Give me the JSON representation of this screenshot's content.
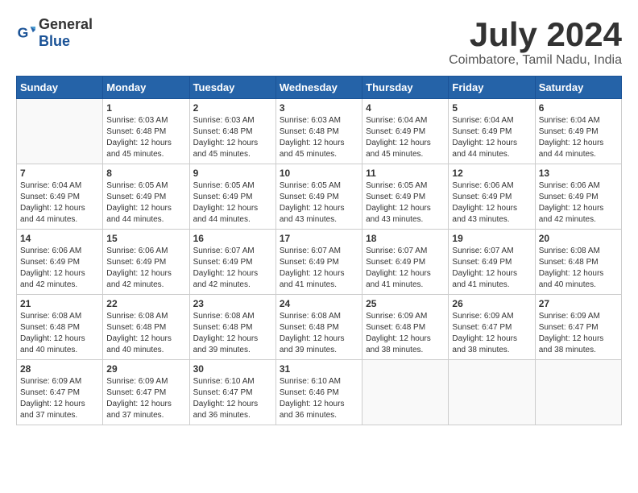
{
  "logo": {
    "general": "General",
    "blue": "Blue"
  },
  "title": {
    "month_year": "July 2024",
    "location": "Coimbatore, Tamil Nadu, India"
  },
  "calendar": {
    "headers": [
      "Sunday",
      "Monday",
      "Tuesday",
      "Wednesday",
      "Thursday",
      "Friday",
      "Saturday"
    ],
    "weeks": [
      [
        {
          "day": "",
          "info": ""
        },
        {
          "day": "1",
          "info": "Sunrise: 6:03 AM\nSunset: 6:48 PM\nDaylight: 12 hours\nand 45 minutes."
        },
        {
          "day": "2",
          "info": "Sunrise: 6:03 AM\nSunset: 6:48 PM\nDaylight: 12 hours\nand 45 minutes."
        },
        {
          "day": "3",
          "info": "Sunrise: 6:03 AM\nSunset: 6:48 PM\nDaylight: 12 hours\nand 45 minutes."
        },
        {
          "day": "4",
          "info": "Sunrise: 6:04 AM\nSunset: 6:49 PM\nDaylight: 12 hours\nand 45 minutes."
        },
        {
          "day": "5",
          "info": "Sunrise: 6:04 AM\nSunset: 6:49 PM\nDaylight: 12 hours\nand 44 minutes."
        },
        {
          "day": "6",
          "info": "Sunrise: 6:04 AM\nSunset: 6:49 PM\nDaylight: 12 hours\nand 44 minutes."
        }
      ],
      [
        {
          "day": "7",
          "info": "Sunrise: 6:04 AM\nSunset: 6:49 PM\nDaylight: 12 hours\nand 44 minutes."
        },
        {
          "day": "8",
          "info": "Sunrise: 6:05 AM\nSunset: 6:49 PM\nDaylight: 12 hours\nand 44 minutes."
        },
        {
          "day": "9",
          "info": "Sunrise: 6:05 AM\nSunset: 6:49 PM\nDaylight: 12 hours\nand 44 minutes."
        },
        {
          "day": "10",
          "info": "Sunrise: 6:05 AM\nSunset: 6:49 PM\nDaylight: 12 hours\nand 43 minutes."
        },
        {
          "day": "11",
          "info": "Sunrise: 6:05 AM\nSunset: 6:49 PM\nDaylight: 12 hours\nand 43 minutes."
        },
        {
          "day": "12",
          "info": "Sunrise: 6:06 AM\nSunset: 6:49 PM\nDaylight: 12 hours\nand 43 minutes."
        },
        {
          "day": "13",
          "info": "Sunrise: 6:06 AM\nSunset: 6:49 PM\nDaylight: 12 hours\nand 42 minutes."
        }
      ],
      [
        {
          "day": "14",
          "info": "Sunrise: 6:06 AM\nSunset: 6:49 PM\nDaylight: 12 hours\nand 42 minutes."
        },
        {
          "day": "15",
          "info": "Sunrise: 6:06 AM\nSunset: 6:49 PM\nDaylight: 12 hours\nand 42 minutes."
        },
        {
          "day": "16",
          "info": "Sunrise: 6:07 AM\nSunset: 6:49 PM\nDaylight: 12 hours\nand 42 minutes."
        },
        {
          "day": "17",
          "info": "Sunrise: 6:07 AM\nSunset: 6:49 PM\nDaylight: 12 hours\nand 41 minutes."
        },
        {
          "day": "18",
          "info": "Sunrise: 6:07 AM\nSunset: 6:49 PM\nDaylight: 12 hours\nand 41 minutes."
        },
        {
          "day": "19",
          "info": "Sunrise: 6:07 AM\nSunset: 6:49 PM\nDaylight: 12 hours\nand 41 minutes."
        },
        {
          "day": "20",
          "info": "Sunrise: 6:08 AM\nSunset: 6:48 PM\nDaylight: 12 hours\nand 40 minutes."
        }
      ],
      [
        {
          "day": "21",
          "info": "Sunrise: 6:08 AM\nSunset: 6:48 PM\nDaylight: 12 hours\nand 40 minutes."
        },
        {
          "day": "22",
          "info": "Sunrise: 6:08 AM\nSunset: 6:48 PM\nDaylight: 12 hours\nand 40 minutes."
        },
        {
          "day": "23",
          "info": "Sunrise: 6:08 AM\nSunset: 6:48 PM\nDaylight: 12 hours\nand 39 minutes."
        },
        {
          "day": "24",
          "info": "Sunrise: 6:08 AM\nSunset: 6:48 PM\nDaylight: 12 hours\nand 39 minutes."
        },
        {
          "day": "25",
          "info": "Sunrise: 6:09 AM\nSunset: 6:48 PM\nDaylight: 12 hours\nand 38 minutes."
        },
        {
          "day": "26",
          "info": "Sunrise: 6:09 AM\nSunset: 6:47 PM\nDaylight: 12 hours\nand 38 minutes."
        },
        {
          "day": "27",
          "info": "Sunrise: 6:09 AM\nSunset: 6:47 PM\nDaylight: 12 hours\nand 38 minutes."
        }
      ],
      [
        {
          "day": "28",
          "info": "Sunrise: 6:09 AM\nSunset: 6:47 PM\nDaylight: 12 hours\nand 37 minutes."
        },
        {
          "day": "29",
          "info": "Sunrise: 6:09 AM\nSunset: 6:47 PM\nDaylight: 12 hours\nand 37 minutes."
        },
        {
          "day": "30",
          "info": "Sunrise: 6:10 AM\nSunset: 6:47 PM\nDaylight: 12 hours\nand 36 minutes."
        },
        {
          "day": "31",
          "info": "Sunrise: 6:10 AM\nSunset: 6:46 PM\nDaylight: 12 hours\nand 36 minutes."
        },
        {
          "day": "",
          "info": ""
        },
        {
          "day": "",
          "info": ""
        },
        {
          "day": "",
          "info": ""
        }
      ]
    ]
  }
}
